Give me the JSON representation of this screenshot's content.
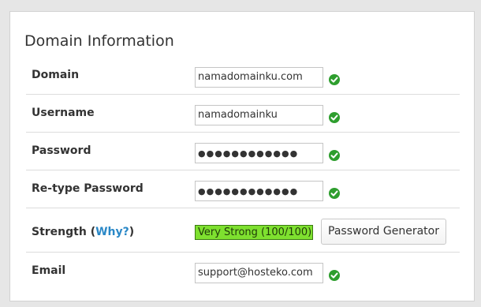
{
  "panel": {
    "title": "Domain Information"
  },
  "form": {
    "domain": {
      "label": "Domain",
      "value": "namadomainku.com"
    },
    "username": {
      "label": "Username",
      "value": "namadomainku"
    },
    "password": {
      "label": "Password",
      "value": "●●●●●●●●●●●●"
    },
    "retype_password": {
      "label": "Re-type Password",
      "value": "●●●●●●●●●●●●"
    },
    "strength": {
      "label": "Strength",
      "why_link": "Why?",
      "open_paren": "(",
      "close_paren": ")",
      "meter_text": "Very Strong (100/100)",
      "meter_color": "#7ee02f"
    },
    "password_generator_button": "Password Generator",
    "email": {
      "label": "Email",
      "value": "support@hosteko.com"
    }
  },
  "icons": {
    "valid": "check-circle-icon",
    "valid_color": "#2e9e2e"
  }
}
